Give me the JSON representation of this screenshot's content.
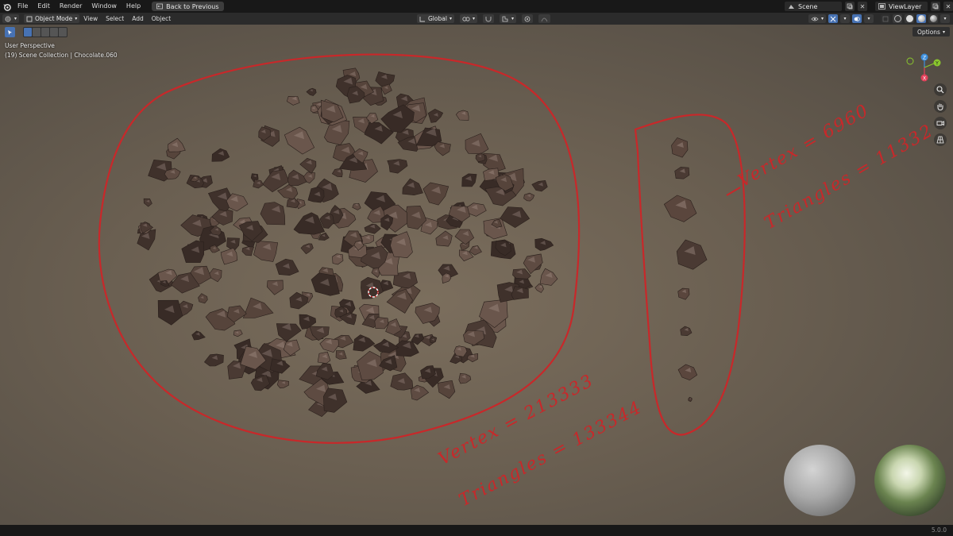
{
  "menubar": {
    "items": [
      "File",
      "Edit",
      "Render",
      "Window",
      "Help"
    ],
    "back_label": "Back to Previous",
    "scene_name": "Scene",
    "view_layer": "ViewLayer"
  },
  "header": {
    "mode": "Object Mode",
    "menus": [
      "View",
      "Select",
      "Add",
      "Object"
    ],
    "orientation": "Global"
  },
  "viewport": {
    "perspective_label": "User Perspective",
    "collection_label": "(19) Scene Collection | Chocolate.060",
    "options_label": "Options",
    "gizmo_axes": {
      "x": "X",
      "y": "Y",
      "z": "Z"
    }
  },
  "annotations": {
    "left_vertices": "Vertex = 213333",
    "left_triangles": "Triangles = 133344",
    "right_vertices": "Vertex = 6960",
    "right_triangles": "Triangles = 11332"
  },
  "statusbar": {
    "version": "5.0.0"
  },
  "colors": {
    "accent": "#4772b3",
    "annotation_red": "#c8282a",
    "axis_x": "#e2415a",
    "axis_y": "#8ac72d",
    "axis_z": "#3d8fdd"
  }
}
